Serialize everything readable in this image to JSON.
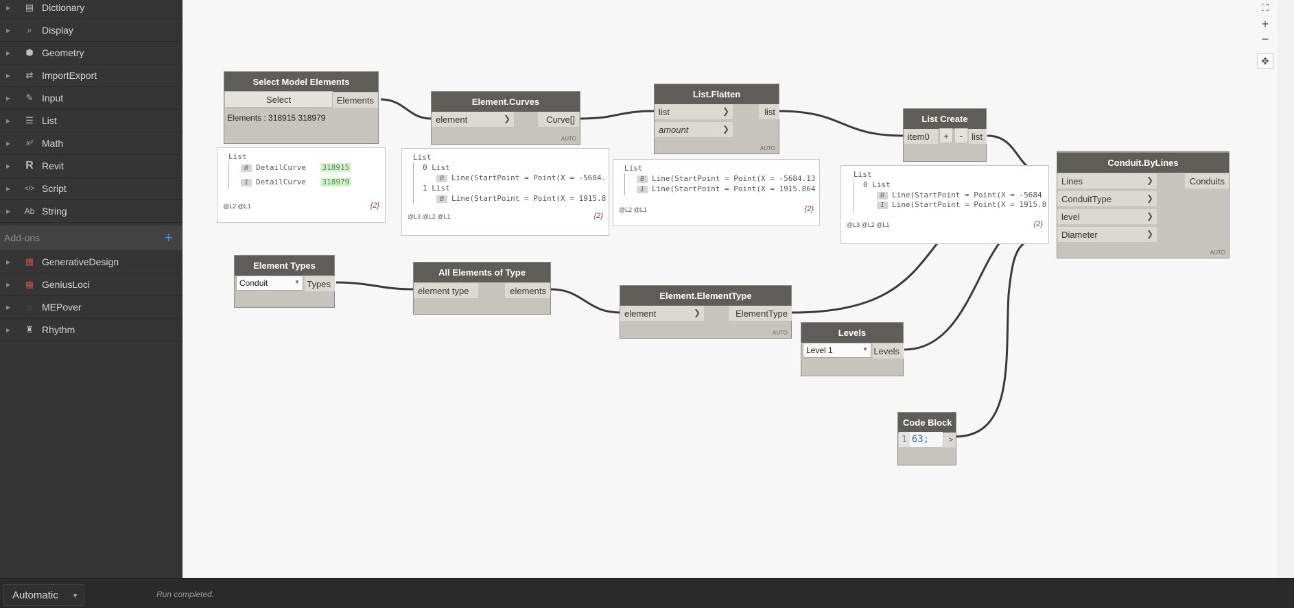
{
  "library": {
    "items": [
      {
        "label": "Dictionary",
        "icon": "dictionary-icon",
        "glyph": "▤"
      },
      {
        "label": "Display",
        "icon": "magnifier-icon",
        "glyph": "⌕"
      },
      {
        "label": "Geometry",
        "icon": "cube-icon",
        "glyph": "⬢"
      },
      {
        "label": "ImportExport",
        "icon": "swap-arrows-icon",
        "glyph": "⇄"
      },
      {
        "label": "Input",
        "icon": "pencil-icon",
        "glyph": "✎"
      },
      {
        "label": "List",
        "icon": "list-icon",
        "glyph": "☰"
      },
      {
        "label": "Math",
        "icon": "math-icon",
        "glyph": "x²"
      },
      {
        "label": "Revit",
        "icon": "revit-icon",
        "glyph": "R"
      },
      {
        "label": "Script",
        "icon": "code-icon",
        "glyph": "</>"
      },
      {
        "label": "String",
        "icon": "string-icon",
        "glyph": "Ab"
      }
    ],
    "addons_label": "Add-ons",
    "addons": [
      {
        "label": "GenerativeDesign",
        "icon": "generativedesign-icon",
        "glyph": "▦"
      },
      {
        "label": "GeniusLoci",
        "icon": "geniusloci-icon",
        "glyph": "▦"
      },
      {
        "label": "MEPover",
        "icon": "mepover-icon",
        "glyph": "◌"
      },
      {
        "label": "Rhythm",
        "icon": "rhythm-icon",
        "glyph": "♜"
      }
    ]
  },
  "status": {
    "run_mode": "Automatic",
    "message": "Run completed."
  },
  "nodes": {
    "select_model_elements": {
      "title": "Select Model Elements",
      "button": "Select",
      "output": "Elements",
      "info": "Elements : 318915 318979"
    },
    "element_curves": {
      "title": "Element.Curves",
      "input": "element",
      "output": "Curve[]",
      "auto": "AUTO"
    },
    "list_flatten": {
      "title": "List.Flatten",
      "input1": "list",
      "input2": "amount",
      "output": "list",
      "auto": "AUTO"
    },
    "list_create": {
      "title": "List Create",
      "input": "item0",
      "add": "+",
      "remove": "-",
      "output": "list"
    },
    "conduit_bylines": {
      "title": "Conduit.ByLines",
      "inputs": [
        "Lines",
        "ConduitType",
        "level",
        "Diameter"
      ],
      "output": "Conduits",
      "auto": "AUTO"
    },
    "element_types": {
      "title": "Element Types",
      "selected": "Conduit",
      "output": "Types"
    },
    "all_elements_of_type": {
      "title": "All Elements of Type",
      "input": "element type",
      "output": "elements"
    },
    "element_elementtype": {
      "title": "Element.ElementType",
      "input": "element",
      "output": "ElementType",
      "auto": "AUTO"
    },
    "levels": {
      "title": "Levels",
      "selected": "Level 1",
      "output": "Levels"
    },
    "code_block": {
      "title": "Code Block",
      "line_no": "1",
      "code": "63;",
      "output": ">"
    }
  },
  "previews": {
    "select": {
      "header": "List",
      "rows": [
        {
          "idx": "0",
          "type": "DetailCurve",
          "id": "318915"
        },
        {
          "idx": "1",
          "type": "DetailCurve",
          "id": "318979"
        }
      ],
      "levels": "@L2 @L1",
      "count": "{2}"
    },
    "curves": {
      "header": "List",
      "sub0": "0 List",
      "sub0_idx": "0",
      "line0": "Line(StartPoint = Point(X = -5684.",
      "sub1": "1 List",
      "sub1_idx": "0",
      "line1": "Line(StartPoint = Point(X = 1915.8",
      "levels": "@L3 @L2 @L1",
      "count": "{2}"
    },
    "flatten": {
      "header": "List",
      "idx0": "0",
      "line0": "Line(StartPoint = Point(X = -5684.13",
      "idx1": "1",
      "line1": "Line(StartPoint = Point(X = 1915.864",
      "levels": "@L2 @L1",
      "count": "{2}"
    },
    "create": {
      "header": "List",
      "sub": "0 List",
      "idx0": "0",
      "line0": "Line(StartPoint = Point(X = -5684",
      "idx1": "1",
      "line1": "Line(StartPoint = Point(X = 1915.8",
      "levels": "@L3 @L2 @L1",
      "count": "{2}"
    }
  }
}
